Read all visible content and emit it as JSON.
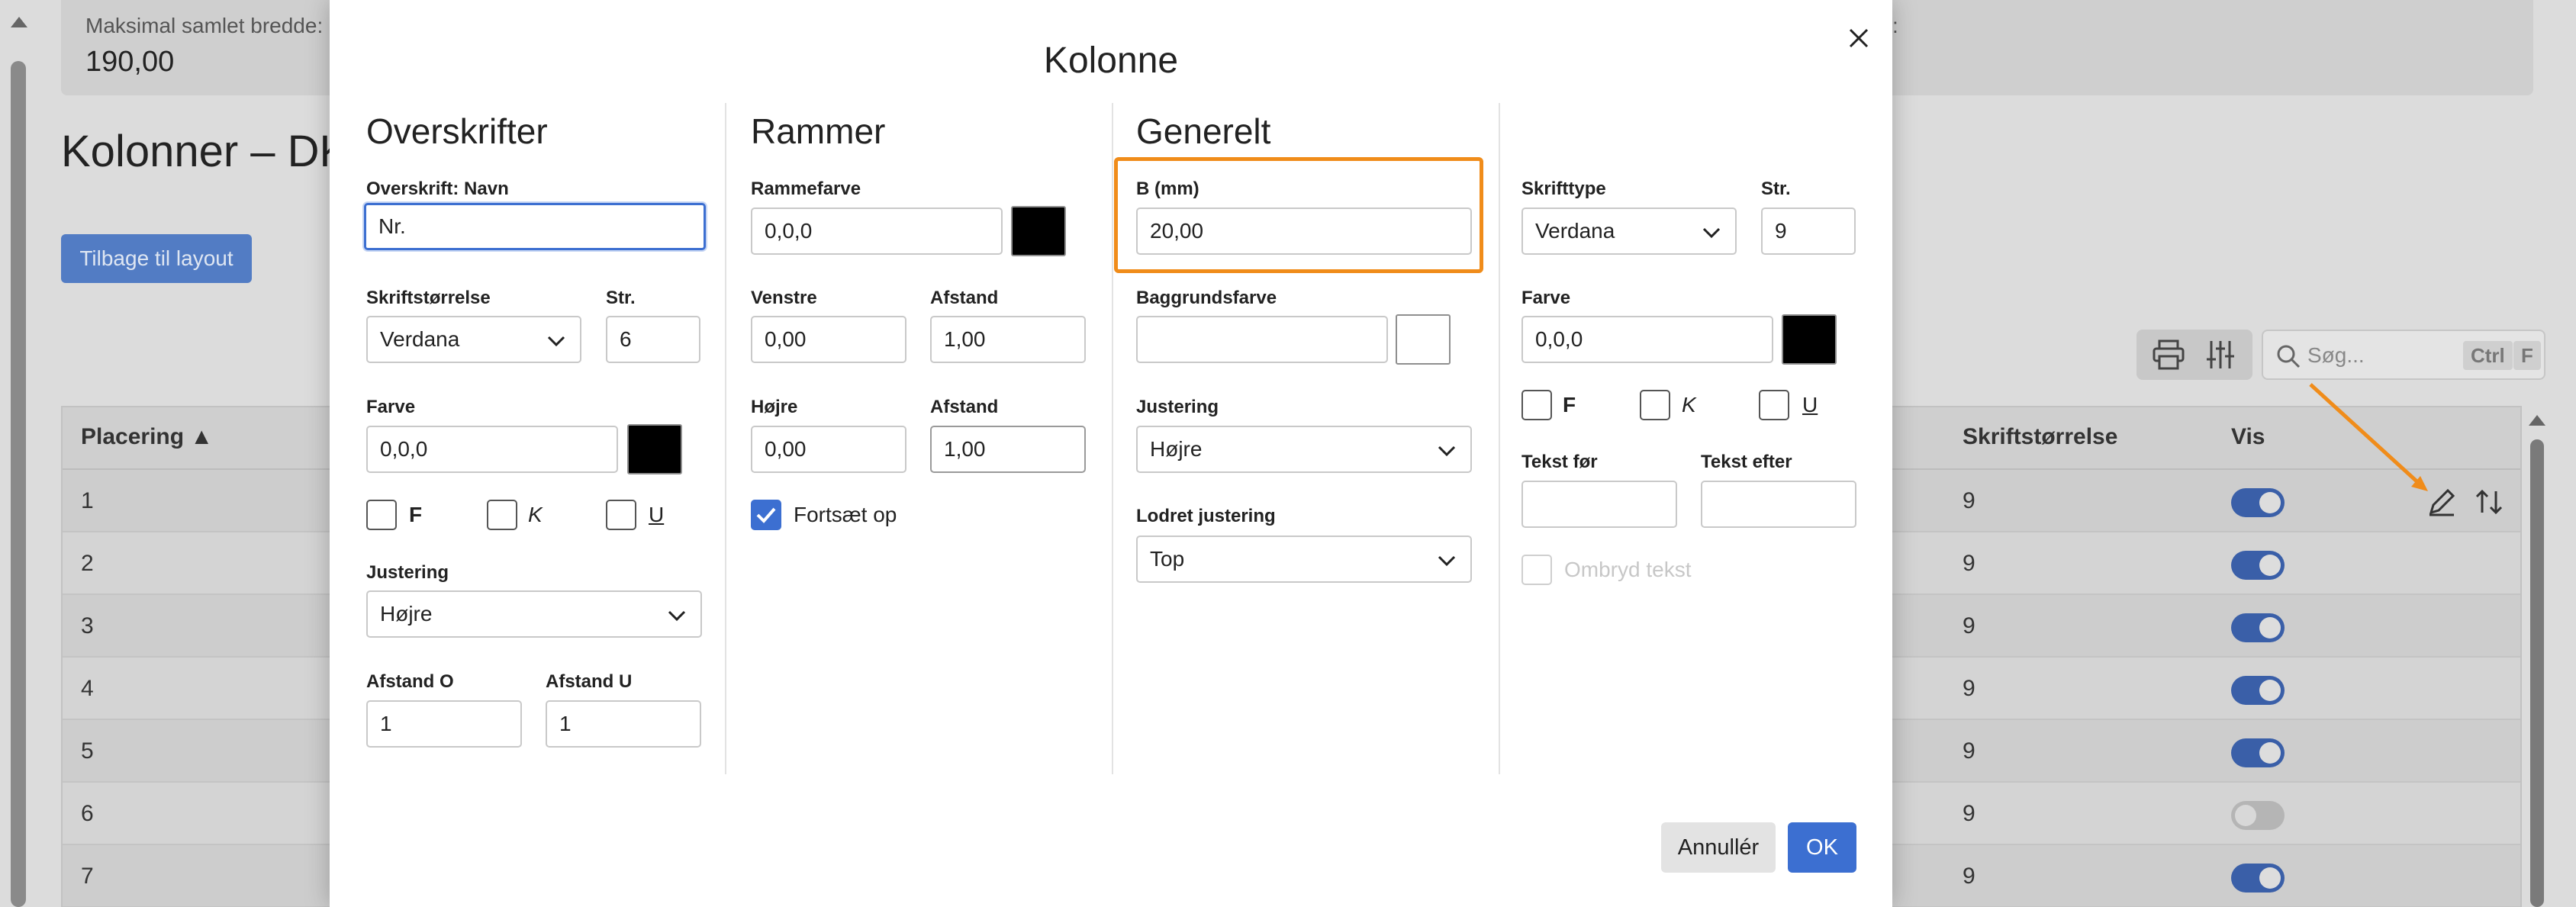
{
  "background": {
    "top_card_label": "Maksimal samlet bredde:",
    "top_card_value": "190,00",
    "top_card_trailing": ":",
    "page_title": "Kolonner – DK",
    "back_button": "Tilbage til layout",
    "search_placeholder": "Søg...",
    "search_kbd_ctrl": "Ctrl",
    "search_kbd_f": "F",
    "table": {
      "col_placering": "Placering ▲",
      "col_skriftstorrelse": "Skriftstørrelse",
      "col_vis": "Vis",
      "rows": [
        {
          "placering": "1",
          "size": "9",
          "vis": true
        },
        {
          "placering": "2",
          "size": "9",
          "vis": true
        },
        {
          "placering": "3",
          "size": "9",
          "vis": true
        },
        {
          "placering": "4",
          "size": "9",
          "vis": true
        },
        {
          "placering": "5",
          "size": "9",
          "vis": true
        },
        {
          "placering": "6",
          "size": "9",
          "vis": false
        },
        {
          "placering": "7",
          "size": "9",
          "vis": true
        }
      ]
    }
  },
  "modal": {
    "title": "Kolonne",
    "overskrifter": {
      "heading": "Overskrifter",
      "navn_label": "Overskrift: Navn",
      "navn_value": "Nr.",
      "font_label": "Skriftstørrelse",
      "font_value": "Verdana",
      "size_label": "Str.",
      "size_value": "6",
      "color_label": "Farve",
      "color_value": "0,0,0",
      "bold_label": "F",
      "italic_label": "K",
      "underline_label": "U",
      "align_label": "Justering",
      "align_value": "Højre",
      "afstand_o_label": "Afstand O",
      "afstand_o_value": "1",
      "afstand_u_label": "Afstand U",
      "afstand_u_value": "1"
    },
    "rammer": {
      "heading": "Rammer",
      "color_label": "Rammefarve",
      "color_value": "0,0,0",
      "left_label": "Venstre",
      "left_value": "0,00",
      "left_spacing_label": "Afstand",
      "left_spacing_value": "1,00",
      "right_label": "Højre",
      "right_value": "0,00",
      "right_spacing_label": "Afstand",
      "right_spacing_value": "1,00",
      "continue_label": "Fortsæt op"
    },
    "generelt": {
      "heading": "Generelt",
      "width_label": "B (mm)",
      "width_value": "20,00",
      "bg_label": "Baggrundsfarve",
      "bg_value": "",
      "align_label": "Justering",
      "align_value": "Højre",
      "valign_label": "Lodret justering",
      "valign_value": "Top"
    },
    "tekst": {
      "font_label": "Skrifttype",
      "font_value": "Verdana",
      "size_label": "Str.",
      "size_value": "9",
      "color_label": "Farve",
      "color_value": "0,0,0",
      "bold_label": "F",
      "italic_label": "K",
      "underline_label": "U",
      "before_label": "Tekst før",
      "after_label": "Tekst efter",
      "wrap_label": "Ombryd tekst"
    },
    "cancel_button": "Annullér",
    "ok_button": "OK"
  },
  "colors": {
    "accent": "#3c6fd1",
    "highlight": "#f08c1a",
    "swatch_black": "#000000"
  }
}
